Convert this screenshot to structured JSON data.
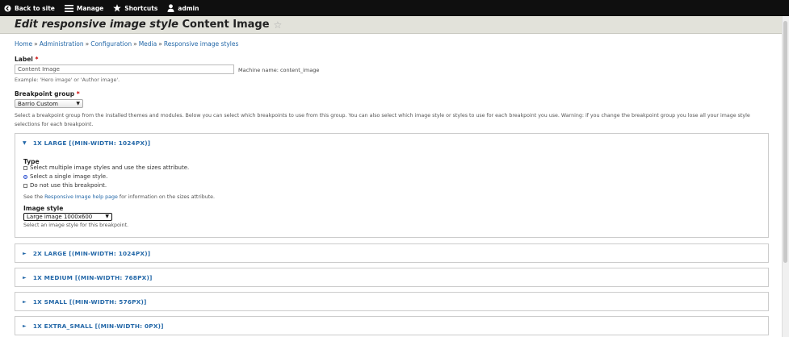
{
  "toolbar": {
    "back": "Back to site",
    "manage": "Manage",
    "shortcuts": "Shortcuts",
    "user": "admin"
  },
  "header": {
    "title_prefix": "Edit responsive image style",
    "title_name": "Content Image"
  },
  "breadcrumb": [
    "Home",
    "Administration",
    "Configuration",
    "Media",
    "Responsive image styles"
  ],
  "form": {
    "label_title": "Label",
    "label_value": "Content Image",
    "machine_name": "Machine name: content_image",
    "label_example": "Example: 'Hero image' or 'Author image'.",
    "bp_group_title": "Breakpoint group",
    "bp_group_value": "Barrio Custom",
    "bp_group_help": "Select a breakpoint group from the installed themes and modules. Below you can select which breakpoints to use from this group. You can also select which image style or styles to use for each breakpoint you use. Warning: if you change the breakpoint group you lose all your image style selections for each breakpoint."
  },
  "breakpoints": [
    {
      "summary": "1X LARGE [(MIN-WIDTH: 1024PX)]",
      "open": true,
      "type_label": "Type",
      "options": [
        "Select multiple image styles and use the sizes attribute.",
        "Select a single image style.",
        "Do not use this breakpoint."
      ],
      "selected": 1,
      "help_pre": "See the ",
      "help_link": "Responsive Image help page",
      "help_post": " for information on the sizes attribute.",
      "image_style_label": "Image style",
      "image_style_value": "Large image 1000x600",
      "image_style_desc": "Select an image style for this breakpoint."
    },
    {
      "summary": "2X LARGE [(MIN-WIDTH: 1024PX)]",
      "open": false
    },
    {
      "summary": "1X MEDIUM [(MIN-WIDTH: 768PX)]",
      "open": false
    },
    {
      "summary": "1X SMALL [(MIN-WIDTH: 576PX)]",
      "open": false
    },
    {
      "summary": "1X EXTRA_SMALL [(MIN-WIDTH: 0PX)]",
      "open": false
    }
  ]
}
